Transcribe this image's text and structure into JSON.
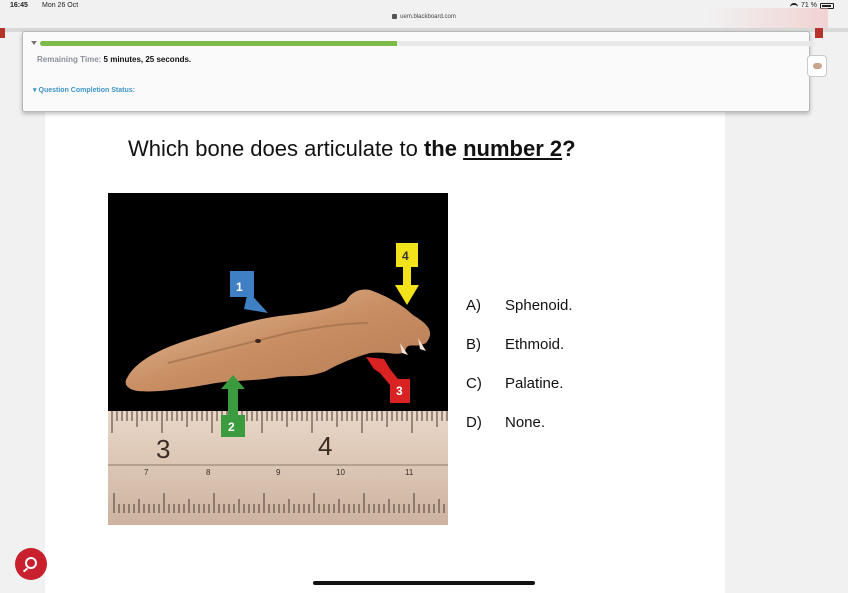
{
  "status": {
    "time": "16:45",
    "date": "Mon 26 Oct",
    "url": "uem.blackboard.com",
    "battery": "71 %"
  },
  "timer": {
    "label": "Remaining Time:",
    "value": "5 minutes, 25 seconds.",
    "progress_fraction": 0.46
  },
  "completion": {
    "label": "Question Completion Status:"
  },
  "question": {
    "prefix": "Which bone does articulate to ",
    "the": "the",
    "number": "number 2",
    "suffix": "?"
  },
  "image": {
    "labels": [
      "1",
      "2",
      "3",
      "4"
    ],
    "ruler_numbers_top": [
      "3",
      "4"
    ],
    "ruler_numbers_bottom": [
      "7",
      "8",
      "9",
      "10",
      "11"
    ]
  },
  "answers": [
    {
      "letter": "A)",
      "text": "Sphenoid."
    },
    {
      "letter": "B)",
      "text": "Ethmoid."
    },
    {
      "letter": "C)",
      "text": "Palatine."
    },
    {
      "letter": "D)",
      "text": "None."
    }
  ],
  "icons": {
    "chat": "chat-bubble-icon",
    "lock": "lock-icon",
    "wifi": "wifi-icon",
    "battery": "battery-icon"
  }
}
